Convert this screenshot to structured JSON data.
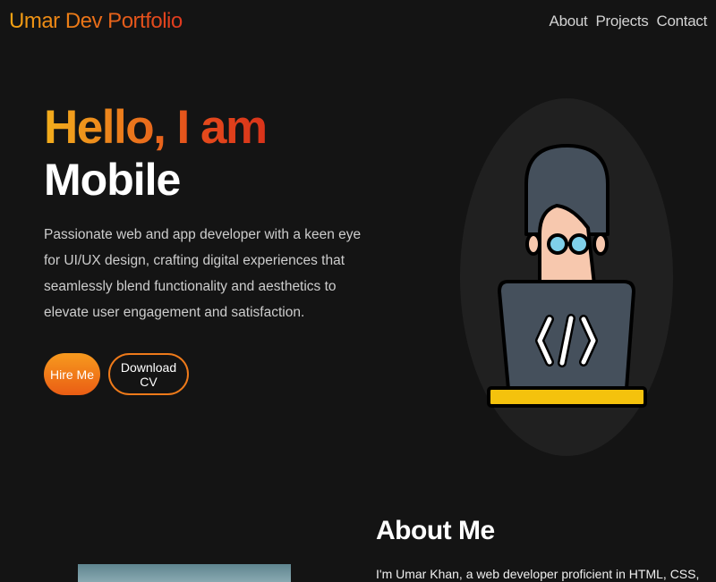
{
  "nav": {
    "brand": "Umar Dev Portfolio",
    "links": [
      "About",
      "Projects",
      "Contact"
    ]
  },
  "hero": {
    "greeting": "Hello, I am",
    "role": "Mobile",
    "description": "Passionate web and app developer with a keen eye for UI/UX design, crafting digital experiences that seamlessly blend functionality and aesthetics to elevate user engagement and satisfaction.",
    "hire_label": "Hire Me",
    "cv_label": "Download CV",
    "illustration_icon": "developer-coding-icon"
  },
  "about": {
    "title": "About Me",
    "text": "I'm Umar Khan, a web developer proficient in HTML, CSS,"
  },
  "colors": {
    "background": "#141414",
    "accent_start": "#f3a312",
    "accent_end": "#e0391f"
  }
}
